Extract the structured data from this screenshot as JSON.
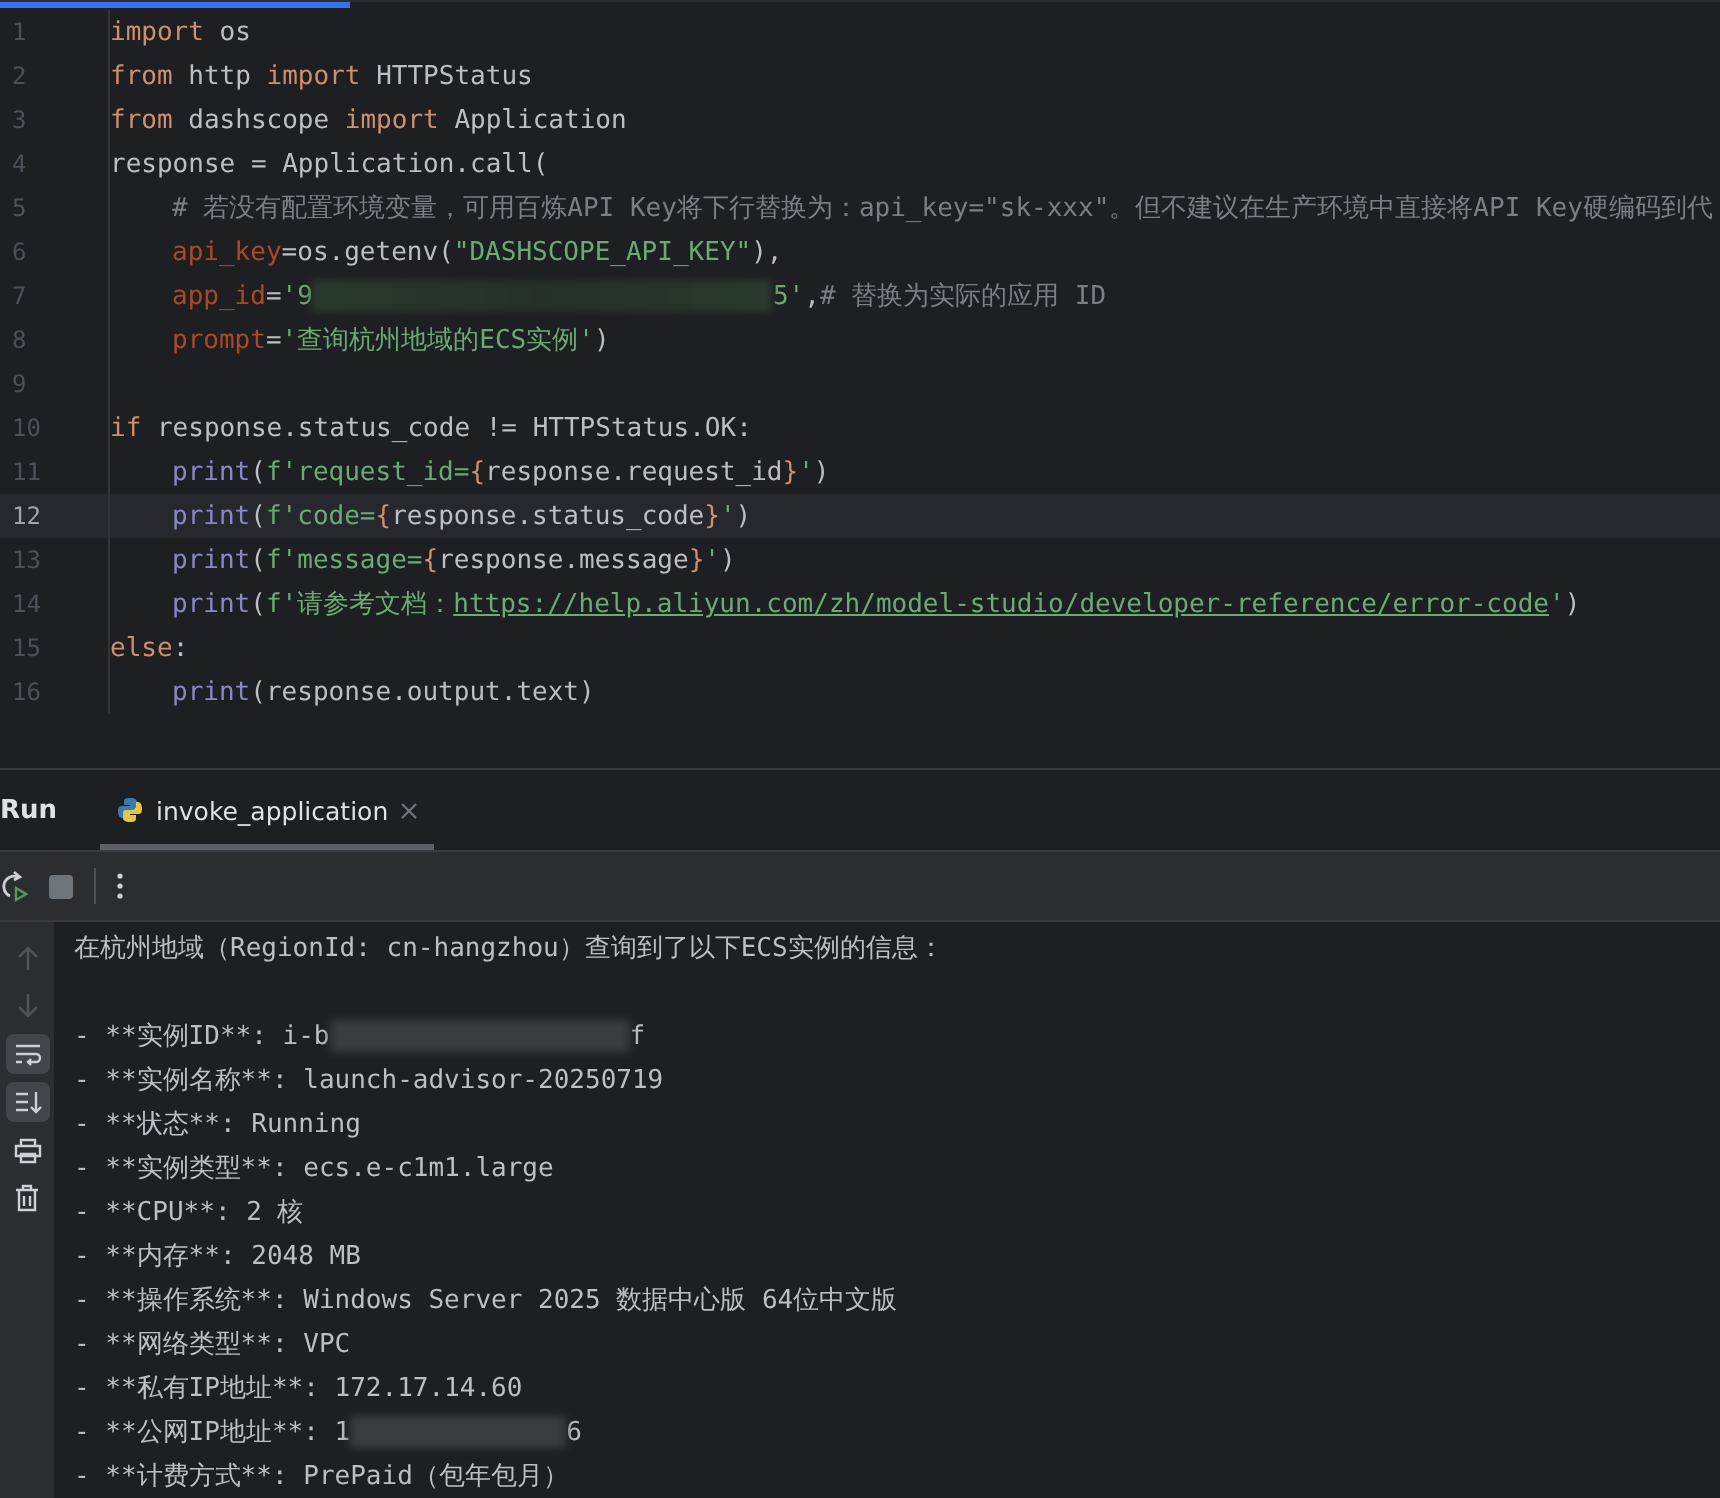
{
  "editor": {
    "lines": [
      {
        "number": "1",
        "current": false,
        "indented": false,
        "tokens": [
          {
            "kind": "kw",
            "text": "import"
          },
          {
            "kind": "plain",
            "text": " os"
          }
        ]
      },
      {
        "number": "2",
        "current": false,
        "indented": false,
        "tokens": [
          {
            "kind": "kw",
            "text": "from"
          },
          {
            "kind": "plain",
            "text": " http "
          },
          {
            "kind": "kw",
            "text": "import"
          },
          {
            "kind": "plain",
            "text": " HTTPStatus"
          }
        ]
      },
      {
        "number": "3",
        "current": false,
        "indented": false,
        "tokens": [
          {
            "kind": "kw",
            "text": "from"
          },
          {
            "kind": "plain",
            "text": " dashscope "
          },
          {
            "kind": "kw",
            "text": "import"
          },
          {
            "kind": "plain",
            "text": " Application"
          }
        ]
      },
      {
        "number": "4",
        "current": false,
        "indented": false,
        "tokens": [
          {
            "kind": "plain",
            "text": "response = Application.call("
          }
        ]
      },
      {
        "number": "5",
        "current": false,
        "indented": true,
        "tokens": [
          {
            "kind": "comment",
            "text": "# 若没有配置环境变量，可用百炼API Key将下行替换为：api_key=\"sk-xxx\"。但不建议在生产环境中直接将API Key硬编码到代"
          }
        ]
      },
      {
        "number": "6",
        "current": false,
        "indented": true,
        "tokens": [
          {
            "kind": "param",
            "text": "api_key"
          },
          {
            "kind": "plain",
            "text": "=os.getenv("
          },
          {
            "kind": "string",
            "text": "\"DASHSCOPE_API_KEY\""
          },
          {
            "kind": "plain",
            "text": "),"
          }
        ]
      },
      {
        "number": "7",
        "current": false,
        "indented": true,
        "tokens": [
          {
            "kind": "param",
            "text": "app_id"
          },
          {
            "kind": "plain",
            "text": "="
          },
          {
            "kind": "string",
            "text": "'9"
          },
          {
            "kind": "redacted"
          },
          {
            "kind": "string",
            "text": "5'"
          },
          {
            "kind": "plain",
            "text": ","
          },
          {
            "kind": "comment",
            "text": "# 替换为实际的应用 ID"
          }
        ]
      },
      {
        "number": "8",
        "current": false,
        "indented": true,
        "tokens": [
          {
            "kind": "param",
            "text": "prompt"
          },
          {
            "kind": "plain",
            "text": "="
          },
          {
            "kind": "string",
            "text": "'查询杭州地域的ECS实例'"
          },
          {
            "kind": "plain",
            "text": ")"
          }
        ]
      },
      {
        "number": "9",
        "current": false
      },
      {
        "number": "10",
        "current": false,
        "indented": false,
        "tokens": [
          {
            "kind": "kw",
            "text": "if"
          },
          {
            "kind": "plain",
            "text": " response.status_code != HTTPStatus.OK:"
          }
        ]
      },
      {
        "number": "11",
        "current": false,
        "indented": true,
        "tokens": [
          {
            "kind": "builtin",
            "text": "print"
          },
          {
            "kind": "plain",
            "text": "("
          },
          {
            "kind": "string",
            "text": "f'request_id="
          },
          {
            "kind": "kw",
            "text": "{"
          },
          {
            "kind": "plain",
            "text": "response.request_id"
          },
          {
            "kind": "kw",
            "text": "}"
          },
          {
            "kind": "string",
            "text": "'"
          },
          {
            "kind": "plain",
            "text": ")"
          }
        ]
      },
      {
        "number": "12",
        "current": true,
        "indented": true,
        "tokens": [
          {
            "kind": "builtin",
            "text": "print"
          },
          {
            "kind": "plain",
            "text": "("
          },
          {
            "kind": "string",
            "text": "f'code="
          },
          {
            "kind": "kw",
            "text": "{"
          },
          {
            "kind": "plain",
            "text": "response.status_code"
          },
          {
            "kind": "kw",
            "text": "}"
          },
          {
            "kind": "string",
            "text": "'"
          },
          {
            "kind": "plain",
            "text": ")"
          }
        ]
      },
      {
        "number": "13",
        "current": false,
        "indented": true,
        "tokens": [
          {
            "kind": "builtin",
            "text": "print"
          },
          {
            "kind": "plain",
            "text": "("
          },
          {
            "kind": "string",
            "text": "f'message="
          },
          {
            "kind": "kw",
            "text": "{"
          },
          {
            "kind": "plain",
            "text": "response.message"
          },
          {
            "kind": "kw",
            "text": "}"
          },
          {
            "kind": "string",
            "text": "'"
          },
          {
            "kind": "plain",
            "text": ")"
          }
        ]
      },
      {
        "number": "14",
        "current": false,
        "indented": true,
        "tokens": [
          {
            "kind": "builtin",
            "text": "print"
          },
          {
            "kind": "plain",
            "text": "("
          },
          {
            "kind": "string",
            "text": "f'请参考文档："
          },
          {
            "kind": "link",
            "text": "https://help.aliyun.com/zh/model-studio/developer-reference/error-code"
          },
          {
            "kind": "string",
            "text": "'"
          },
          {
            "kind": "plain",
            "text": ")"
          }
        ]
      },
      {
        "number": "15",
        "current": false,
        "indented": false,
        "tokens": [
          {
            "kind": "kw",
            "text": "else"
          },
          {
            "kind": "plain",
            "text": ":"
          }
        ]
      },
      {
        "number": "16",
        "current": false,
        "indented": true,
        "tokens": [
          {
            "kind": "builtin",
            "text": "print"
          },
          {
            "kind": "plain",
            "text": "(response.output.text)"
          }
        ]
      }
    ]
  },
  "run_panel": {
    "title": "Run",
    "tabs": [
      {
        "label": "invoke_application",
        "selected": true
      }
    ],
    "output": [
      [
        {
          "text": "在杭州地域（RegionId: cn-hangzhou）查询到了以下ECS实例的信息："
        }
      ],
      {
        "kind": "blank"
      },
      [
        {
          "text": "- **实例ID**: i-b"
        },
        {
          "kind": "redacted"
        },
        {
          "text": "f"
        }
      ],
      [
        {
          "text": "- **实例名称**: launch-advisor-20250719"
        }
      ],
      [
        {
          "text": "- **状态**: Running"
        }
      ],
      [
        {
          "text": "- **实例类型**: ecs.e-c1m1.large"
        }
      ],
      [
        {
          "text": "- **CPU**: 2 核"
        }
      ],
      [
        {
          "text": "- **内存**: 2048 MB"
        }
      ],
      [
        {
          "text": "- **操作系统**: Windows Server 2025 数据中心版 64位中文版"
        }
      ],
      [
        {
          "text": "- **网络类型**: VPC"
        }
      ],
      [
        {
          "text": "- **私有IP地址**: 172.17.14.60"
        }
      ],
      [
        {
          "text": "- **公网IP地址**: 1"
        },
        {
          "kind": "redacted"
        },
        {
          "text": "6"
        }
      ],
      [
        {
          "text": "- **计费方式**: PrePaid（包年包月）"
        }
      ]
    ]
  }
}
